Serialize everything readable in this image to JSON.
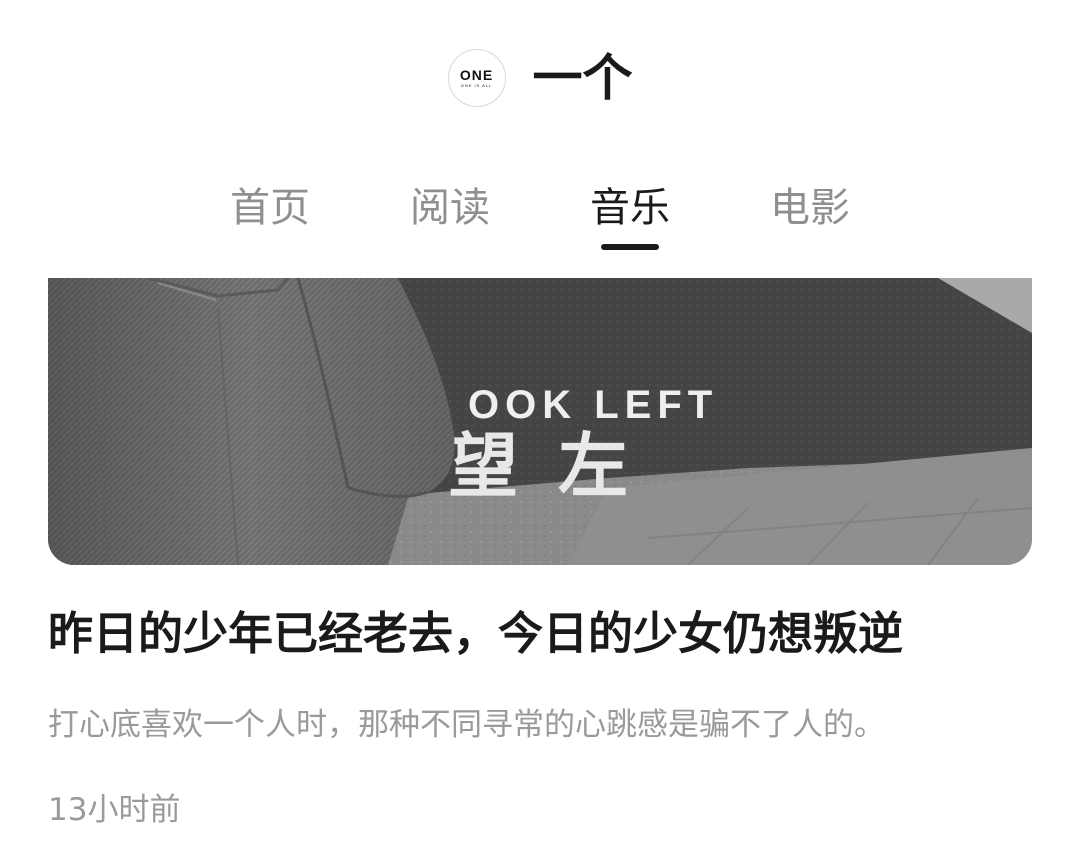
{
  "header": {
    "logo": {
      "main": "ONE",
      "sub": "ONE IS ALL"
    },
    "app_name": "一个"
  },
  "tabs": [
    {
      "label": "首页",
      "active": false
    },
    {
      "label": "阅读",
      "active": false
    },
    {
      "label": "音乐",
      "active": true
    },
    {
      "label": "电影",
      "active": false
    }
  ],
  "article": {
    "cover": {
      "road_text_en": "OOK LEFT",
      "road_text_zh": "望左",
      "style": "grayscale photo"
    },
    "title": "昨日的少年已经老去，今日的少女仍想叛逆",
    "summary": "打心底喜欢一个人时，那种不同寻常的心跳感是骗不了人的。",
    "time": "13小时前"
  },
  "colors": {
    "text_primary": "#1a1a1a",
    "text_secondary": "#9a9a9a",
    "tab_inactive": "#8f8f8f",
    "background": "#ffffff"
  }
}
